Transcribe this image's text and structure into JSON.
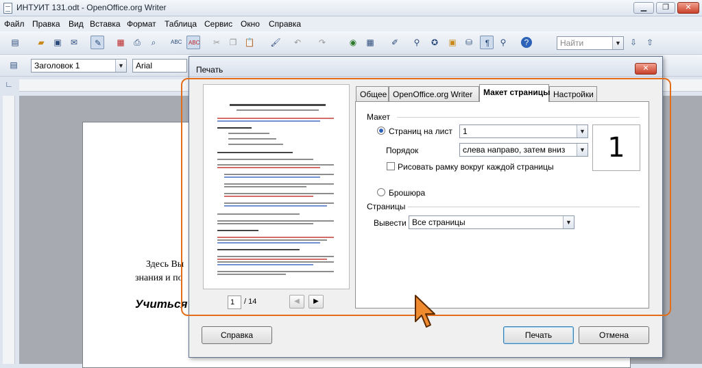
{
  "window": {
    "title": "ИНТУИТ 131.odt - OpenOffice.org Writer",
    "min": "▁",
    "max": "❐",
    "close": "✕"
  },
  "menu": [
    "Файл",
    "Правка",
    "Вид",
    "Вставка",
    "Формат",
    "Таблица",
    "Сервис",
    "Окно",
    "Справка"
  ],
  "toolbar": {
    "search_placeholder": "Найти"
  },
  "format_bar": {
    "style": "Заголовок 1",
    "font": "Arial"
  },
  "document": {
    "text_line1": "Здесь Вы",
    "text_line2": "знания и по",
    "heading_fragment": "Учиться"
  },
  "dialog": {
    "title": "Печать",
    "close_label": "✕",
    "tabs": [
      "Общее",
      "OpenOffice.org Writer",
      "Макет страницы",
      "Настройки"
    ],
    "selected_tab": 2,
    "layout": {
      "section_label": "Макет",
      "pages_per_sheet_label": "Страниц на лист",
      "pages_per_sheet_value": "1",
      "order_label": "Порядок",
      "order_value": "слева направо, затем вниз",
      "draw_border_label": "Рисовать рамку вокруг каждой страницы",
      "brochure_label": "Брошюра",
      "preview_number": "1"
    },
    "pages": {
      "section_label": "Страницы",
      "output_label": "Вывести",
      "output_value": "Все страницы"
    },
    "preview": {
      "current_page": "1",
      "total_pages": "/ 14",
      "prev": "◀",
      "next": "▶"
    },
    "buttons": {
      "help": "Справка",
      "print": "Печать",
      "cancel": "Отмена"
    }
  },
  "colors": {
    "highlight": "#e36c18",
    "accent": "#2c62b8"
  }
}
